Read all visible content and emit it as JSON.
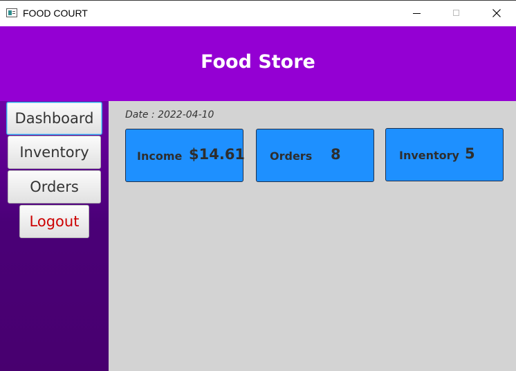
{
  "window": {
    "title": "FOOD COURT",
    "minimize_icon": "minimize-icon",
    "maximize_icon": "maximize-icon",
    "close_icon": "close-icon"
  },
  "header": {
    "title": "Food Store",
    "background": "#9400d3"
  },
  "sidebar": {
    "items": [
      {
        "label": "Dashboard",
        "selected": true
      },
      {
        "label": "Inventory"
      },
      {
        "label": "Orders"
      },
      {
        "label": "Logout",
        "color": "#cc0000"
      }
    ]
  },
  "main": {
    "date": "Date : 2022-04-10",
    "cards": [
      {
        "label": "Income",
        "value": "$14.61"
      },
      {
        "label": "Orders",
        "value": "8"
      },
      {
        "label": "Inventory",
        "value": "5"
      }
    ],
    "card_color": "#1e90ff"
  }
}
